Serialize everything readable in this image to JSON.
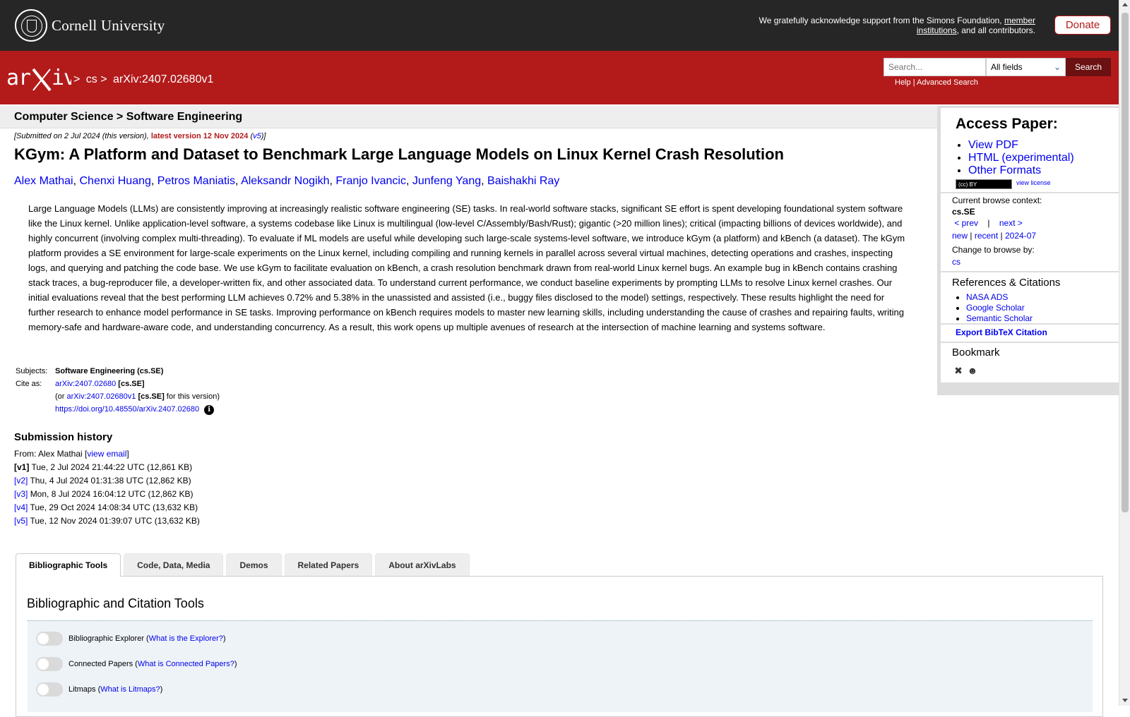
{
  "header": {
    "university": "Cornell University",
    "support_text": "We gratefully acknowledge support from the Simons Foundation,",
    "support_link": "member institutions",
    "support_tail": ", and all contributors.",
    "donate_label": "Donate"
  },
  "nav": {
    "logo": "arXiv",
    "crumb_sep": ">",
    "crumb_cs": "cs",
    "crumb_paper": "arXiv:2407.02680v1",
    "search_placeholder": "Search...",
    "search_field": "All fields",
    "search_button": "Search",
    "help": "Help",
    "advanced": "Advanced Search"
  },
  "subheader": "Computer Science > Software Engineering",
  "paper": {
    "submitted": "[Submitted on 2 Jul 2024 (this version),",
    "latest": "latest version 12 Nov 2024",
    "latest_version": "v5",
    "title": "KGym: A Platform and Dataset to Benchmark Large Language Models on Linux Kernel Crash Resolution",
    "authors": [
      "Alex Mathai",
      "Chenxi Huang",
      "Petros Maniatis",
      "Aleksandr Nogikh",
      "Franjo Ivancic",
      "Junfeng Yang",
      "Baishakhi Ray"
    ],
    "abstract": "Large Language Models (LLMs) are consistently improving at increasingly realistic software engineering (SE) tasks. In real-world software stacks, significant SE effort is spent developing foundational system software like the Linux kernel. Unlike application-level software, a systems codebase like Linux is multilingual (low-level C/Assembly/Bash/Rust); gigantic (>20 million lines); critical (impacting billions of devices worldwide), and highly concurrent (involving complex multi-threading). To evaluate if ML models are useful while developing such large-scale systems-level software, we introduce kGym (a platform) and kBench (a dataset). The kGym platform provides a SE environment for large-scale experiments on the Linux kernel, including compiling and running kernels in parallel across several virtual machines, detecting operations and crashes, inspecting logs, and querying and patching the code base. We use kGym to facilitate evaluation on kBench, a crash resolution benchmark drawn from real-world Linux kernel bugs. An example bug in kBench contains crashing stack traces, a bug-reproducer file, a developer-written fix, and other associated data. To understand current performance, we conduct baseline experiments by prompting LLMs to resolve Linux kernel crashes. Our initial evaluations reveal that the best performing LLM achieves 0.72% and 5.38% in the unassisted and assisted (i.e., buggy files disclosed to the model) settings, respectively. These results highlight the need for further research to enhance model performance in SE tasks. Improving performance on kBench requires models to master new learning skills, including understanding the cause of crashes and repairing faults, writing memory-safe and hardware-aware code, and understanding concurrency. As a result, this work opens up multiple avenues of research at the intersection of machine learning and systems software.",
    "subjects_label": "Subjects:",
    "subjects": "Software Engineering (cs.SE)",
    "cite_label": "Cite as:",
    "cite_id": "arXiv:2407.02680",
    "cite_tag": "[cs.SE]",
    "cite_or": "(or",
    "cite_v1": "arXiv:2407.02680v1",
    "cite_v1_tag": "[cs.SE]",
    "cite_v1_tail": "for this version)",
    "doi": "https://doi.org/10.48550/arXiv.2407.02680",
    "info_icon": "i"
  },
  "history": {
    "title": "Submission history",
    "from": "From: Alex Mathai [",
    "view_email": "view email",
    "versions": [
      {
        "v": "[v1]",
        "text": "Tue, 2 Jul 2024 21:44:22 UTC (12,861 KB)"
      },
      {
        "v": "[v2]",
        "text": "Thu, 4 Jul 2024 01:31:38 UTC (12,862 KB)"
      },
      {
        "v": "[v3]",
        "text": "Mon, 8 Jul 2024 16:04:12 UTC (12,862 KB)"
      },
      {
        "v": "[v4]",
        "text": "Tue, 29 Oct 2024 14:08:34 UTC (13,632 KB)"
      },
      {
        "v": "[v5]",
        "text": "Tue, 12 Nov 2024 01:39:07 UTC (13,632 KB)"
      }
    ]
  },
  "tabs": [
    "Bibliographic Tools",
    "Code, Data, Media",
    "Demos",
    "Related Papers",
    "About arXivLabs"
  ],
  "tools": {
    "title": "Bibliographic and Citation Tools",
    "items": [
      {
        "name": "Bibliographic Explorer",
        "link": "What is the Explorer?"
      },
      {
        "name": "Connected Papers",
        "link": "What is Connected Papers?"
      },
      {
        "name": "Litmaps",
        "link": "What is Litmaps?"
      }
    ]
  },
  "sidebar": {
    "access_title": "Access Paper:",
    "access_links": [
      "View PDF",
      "HTML (experimental)",
      "Other Formats"
    ],
    "license_badge": "(cc) BY",
    "view_license": "view license",
    "context_label": "Current browse context:",
    "context_value": "cs.SE",
    "prev": "< prev",
    "sep": "|",
    "next": "next >",
    "new": "new",
    "recent": "recent",
    "month": "2024-07",
    "change_label": "Change to browse by:",
    "change_link": "cs",
    "refs_title": "References & Citations",
    "refs": [
      "NASA ADS",
      "Google Scholar",
      "Semantic Scholar"
    ],
    "bibtex": "Export BibTeX Citation",
    "bookmark_title": "Bookmark"
  }
}
